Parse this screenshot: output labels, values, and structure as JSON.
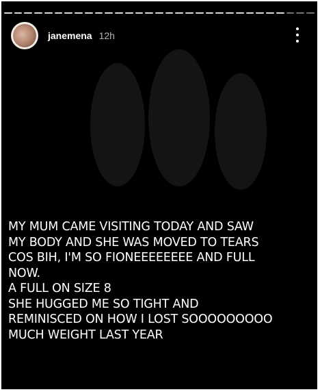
{
  "story": {
    "username": "janemena",
    "time": "12h",
    "caption_lines": [
      "MY MUM CAME VISITING TODAY AND SAW",
      "MY BODY AND SHE WAS MOVED TO TEARS",
      "COS BIH, I'M SO FIONEEEEEEEE AND FULL",
      "NOW.",
      "A FULL ON SIZE 8",
      "SHE HUGGED ME SO TIGHT AND",
      "REMINISCED ON HOW I LOST SOOOOOOOOO",
      "MUCH WEIGHT LAST YEAR"
    ]
  },
  "icons": {
    "more": "more-vertical-icon",
    "avatar": "avatar"
  },
  "colors": {
    "background": "#000000",
    "text": "#ffffff",
    "frame": "#ffffff"
  }
}
